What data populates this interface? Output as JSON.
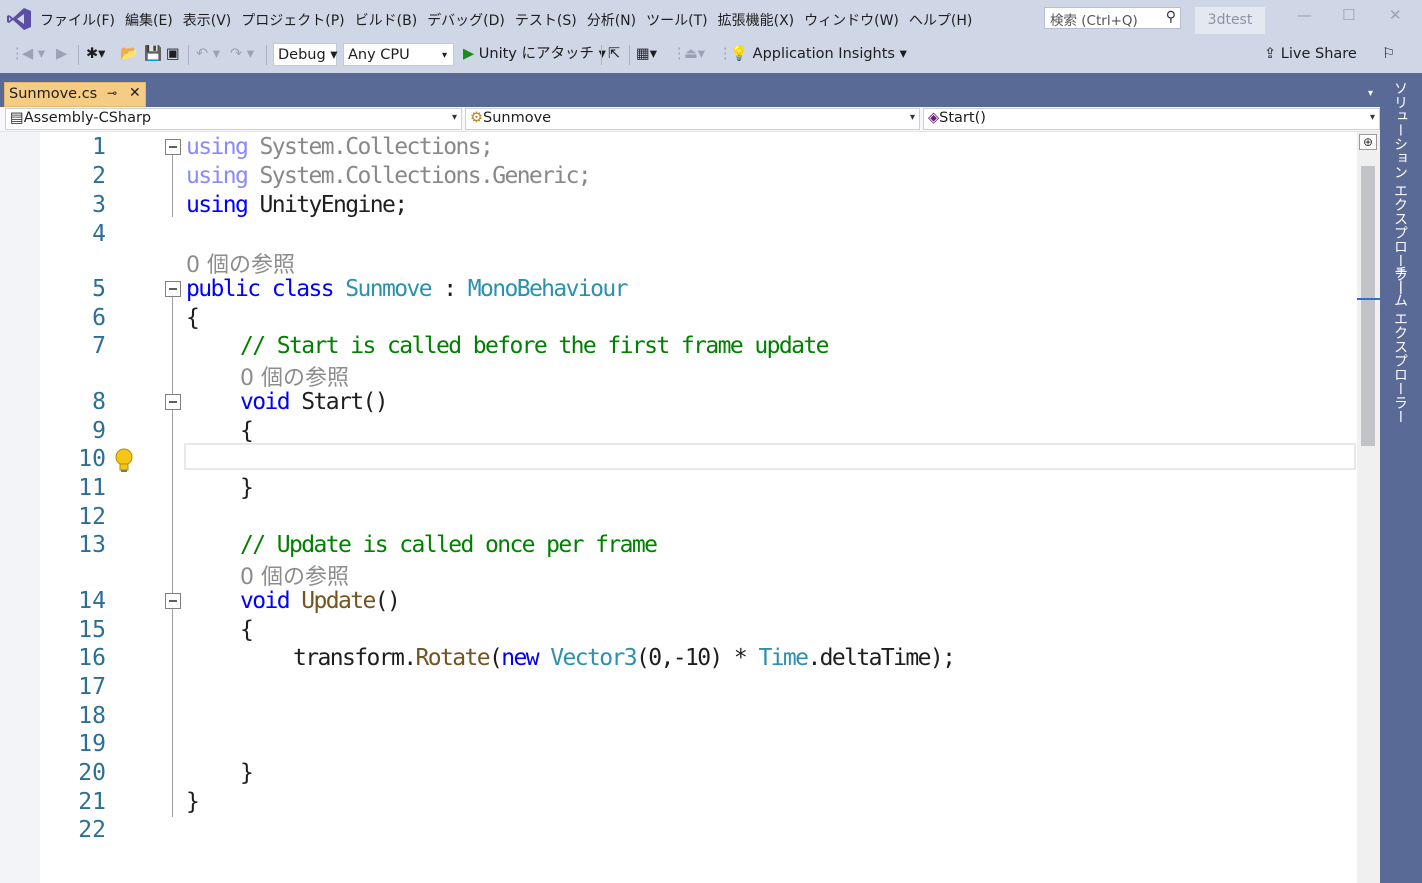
{
  "menubar": {
    "items": [
      "ファイル(F)",
      "編集(E)",
      "表示(V)",
      "プロジェクト(P)",
      "ビルド(B)",
      "デバッグ(D)",
      "テスト(S)",
      "分析(N)",
      "ツール(T)",
      "拡張機能(X)",
      "ウィンドウ(W)",
      "ヘルプ(H)"
    ],
    "search_placeholder": "検索 (Ctrl+Q)",
    "project_name": "3dtest"
  },
  "toolbar": {
    "config": "Debug",
    "platform": "Any CPU",
    "attach": "Unity にアタッチ",
    "insights": "Application Insights",
    "live_share": "Live Share"
  },
  "tabs": [
    {
      "label": "Sunmove.cs",
      "active": true
    }
  ],
  "navbar": {
    "project": "Assembly-CSharp",
    "class": "Sunmove",
    "member": "Start()"
  },
  "side_panel": {
    "solution_explorer": "ソリューション エクスプローラー",
    "team_explorer": "チーム エクスプローラー"
  },
  "editor": {
    "line_numbers": [
      "1",
      "2",
      "3",
      "4",
      "5",
      "6",
      "7",
      "8",
      "9",
      "10",
      "11",
      "12",
      "13",
      "14",
      "15",
      "16",
      "17",
      "18",
      "19",
      "20",
      "21",
      "22"
    ],
    "lens_class": "0 個の参照",
    "lens_start": "0 個の参照",
    "lens_update": "0 個の参照",
    "code": {
      "using_kw": "using",
      "ns1": " System.Collections;",
      "ns2": " System.Collections.Generic;",
      "ns3": " UnityEngine;",
      "public_class": "public class",
      "class_name": "Sunmove",
      "colon": " : ",
      "base_class": "MonoBehaviour",
      "open_brace": "{",
      "close_brace": "}",
      "comment_start": "// Start is called before the first frame update",
      "void_kw": "void",
      "start_name": "Start",
      "parens": "()",
      "comment_update": "// Update is called once per frame",
      "update_name": "Update",
      "transform": "transform.",
      "rotate": "Rotate",
      "paren_open": "(",
      "new_kw": "new",
      "vector3": "Vector3",
      "args": "(0,-10) * ",
      "time": "Time",
      "delta": ".deltaTime);"
    }
  },
  "colors": {
    "chrome": "#cfd6e5",
    "strip": "#5a6a96",
    "active_tab": "#f5cc84",
    "keyword": "#0000ff",
    "type": "#2b91af",
    "comment": "#008000",
    "line_number": "#2b6f96"
  }
}
